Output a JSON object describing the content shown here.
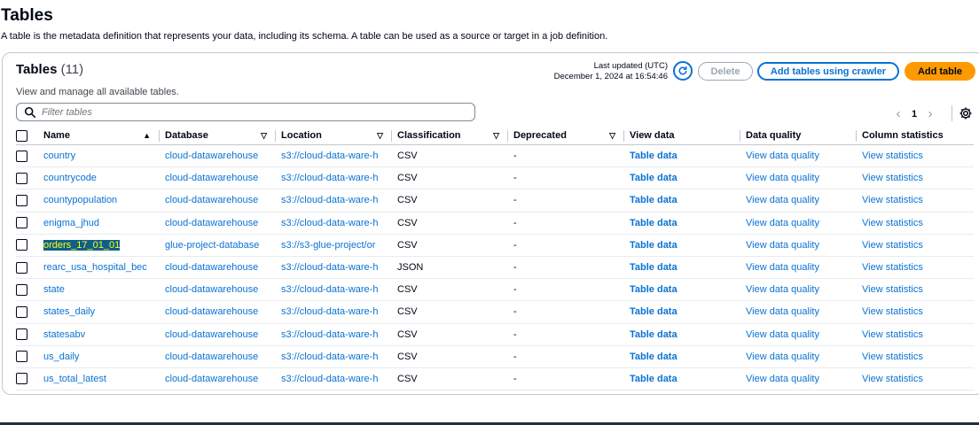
{
  "page": {
    "title": "Tables",
    "description": "A table is the metadata definition that represents your data, including its schema. A table can be used as a source or target in a job definition."
  },
  "header": {
    "title": "Tables",
    "count": "(11)",
    "description": "View and manage all available tables.",
    "last_updated_label": "Last updated (UTC)",
    "last_updated_value": "December 1, 2024 at 16:54:46",
    "refresh_icon": "refresh-icon",
    "delete_label": "Delete",
    "crawler_label": "Add tables using crawler",
    "add_table_label": "Add table"
  },
  "filter": {
    "placeholder": "Filter tables",
    "icon": "search-icon"
  },
  "pagination": {
    "prev": "‹",
    "page": "1",
    "next": "›",
    "settings_icon": "gear-icon"
  },
  "columns": [
    "Name",
    "Database",
    "Location",
    "Classification",
    "Deprecated",
    "View data",
    "Data quality",
    "Column statistics"
  ],
  "rows": [
    {
      "name": "country",
      "database": "cloud-datawarehouse",
      "location": "s3://cloud-data-ware-h",
      "classification": "CSV",
      "deprecated": "-",
      "view_data": "Table data",
      "data_quality": "View data quality",
      "column_statistics": "View statistics"
    },
    {
      "name": "countrycode",
      "database": "cloud-datawarehouse",
      "location": "s3://cloud-data-ware-h",
      "classification": "CSV",
      "deprecated": "-",
      "view_data": "Table data",
      "data_quality": "View data quality",
      "column_statistics": "View statistics"
    },
    {
      "name": "countypopulation",
      "database": "cloud-datawarehouse",
      "location": "s3://cloud-data-ware-h",
      "classification": "CSV",
      "deprecated": "-",
      "view_data": "Table data",
      "data_quality": "View data quality",
      "column_statistics": "View statistics"
    },
    {
      "name": "enigma_jhud",
      "database": "cloud-datawarehouse",
      "location": "s3://cloud-data-ware-h",
      "classification": "CSV",
      "deprecated": "-",
      "view_data": "Table data",
      "data_quality": "View data quality",
      "column_statistics": "View statistics"
    },
    {
      "name": "orders_17_01_01",
      "database": "glue-project-database",
      "location": "s3://s3-glue-project/or",
      "classification": "CSV",
      "deprecated": "-",
      "view_data": "Table data",
      "data_quality": "View data quality",
      "column_statistics": "View statistics"
    },
    {
      "name": "rearc_usa_hospital_bec",
      "database": "cloud-datawarehouse",
      "location": "s3://cloud-data-ware-h",
      "classification": "JSON",
      "deprecated": "-",
      "view_data": "Table data",
      "data_quality": "View data quality",
      "column_statistics": "View statistics"
    },
    {
      "name": "state",
      "database": "cloud-datawarehouse",
      "location": "s3://cloud-data-ware-h",
      "classification": "CSV",
      "deprecated": "-",
      "view_data": "Table data",
      "data_quality": "View data quality",
      "column_statistics": "View statistics"
    },
    {
      "name": "states_daily",
      "database": "cloud-datawarehouse",
      "location": "s3://cloud-data-ware-h",
      "classification": "CSV",
      "deprecated": "-",
      "view_data": "Table data",
      "data_quality": "View data quality",
      "column_statistics": "View statistics"
    },
    {
      "name": "statesabv",
      "database": "cloud-datawarehouse",
      "location": "s3://cloud-data-ware-h",
      "classification": "CSV",
      "deprecated": "-",
      "view_data": "Table data",
      "data_quality": "View data quality",
      "column_statistics": "View statistics"
    },
    {
      "name": "us_daily",
      "database": "cloud-datawarehouse",
      "location": "s3://cloud-data-ware-h",
      "classification": "CSV",
      "deprecated": "-",
      "view_data": "Table data",
      "data_quality": "View data quality",
      "column_statistics": "View statistics"
    },
    {
      "name": "us_total_latest",
      "database": "cloud-datawarehouse",
      "location": "s3://cloud-data-ware-h",
      "classification": "CSV",
      "deprecated": "-",
      "view_data": "Table data",
      "data_quality": "View data quality",
      "column_statistics": "View statistics"
    }
  ],
  "highlighted_row_index": 4,
  "colors": {
    "accent": "#0972d3",
    "primary_button": "#ff9900",
    "highlight": "#ffff00",
    "selection": "#0f5f8c"
  }
}
